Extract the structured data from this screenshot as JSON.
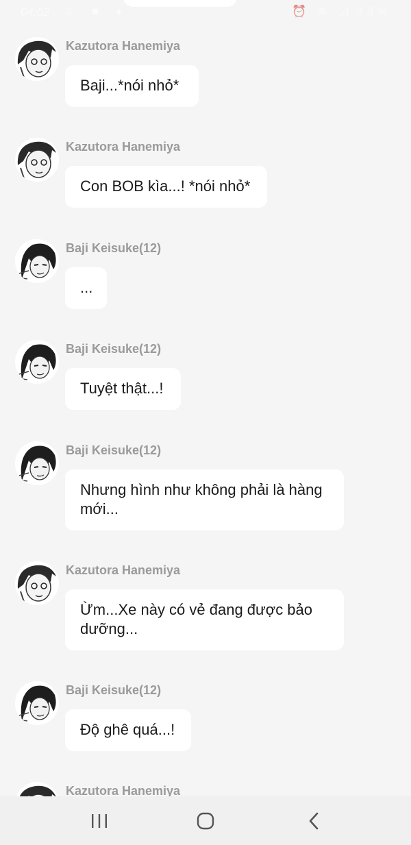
{
  "status_bar": {
    "time": "04:02",
    "battery": "33%"
  },
  "messages": [
    {
      "sender": "Kazutora Hanemiya",
      "avatar": "kazutora-avatar",
      "text": "Baji...*nói nhỏ*"
    },
    {
      "sender": "Kazutora Hanemiya",
      "avatar": "kazutora-avatar",
      "text": "Con BOB kìa...! *nói nhỏ*"
    },
    {
      "sender": "Baji Keisuke(12)",
      "avatar": "baji-avatar",
      "text": "..."
    },
    {
      "sender": "Baji Keisuke(12)",
      "avatar": "baji-avatar",
      "text": "Tuyệt thật...!"
    },
    {
      "sender": "Baji Keisuke(12)",
      "avatar": "baji-avatar",
      "text": "Nhưng hình như không phải là hàng mới..."
    },
    {
      "sender": "Kazutora Hanemiya",
      "avatar": "kazutora-avatar",
      "text": "Ừm...Xe này có vẻ đang được bảo dưỡng..."
    },
    {
      "sender": "Baji Keisuke(12)",
      "avatar": "baji-avatar",
      "text": "Độ ghê quá...!"
    },
    {
      "sender": "Kazutora Hanemiya",
      "avatar": "kazutora-avatar",
      "text": ""
    }
  ],
  "navigation": {
    "icons": [
      "recent-apps-icon",
      "home-icon",
      "back-icon"
    ]
  },
  "colors": {
    "background": "#f5f5f5",
    "bubble": "#ffffff",
    "sender_name": "#9a9a9a",
    "message_text": "#1b1b1b"
  }
}
